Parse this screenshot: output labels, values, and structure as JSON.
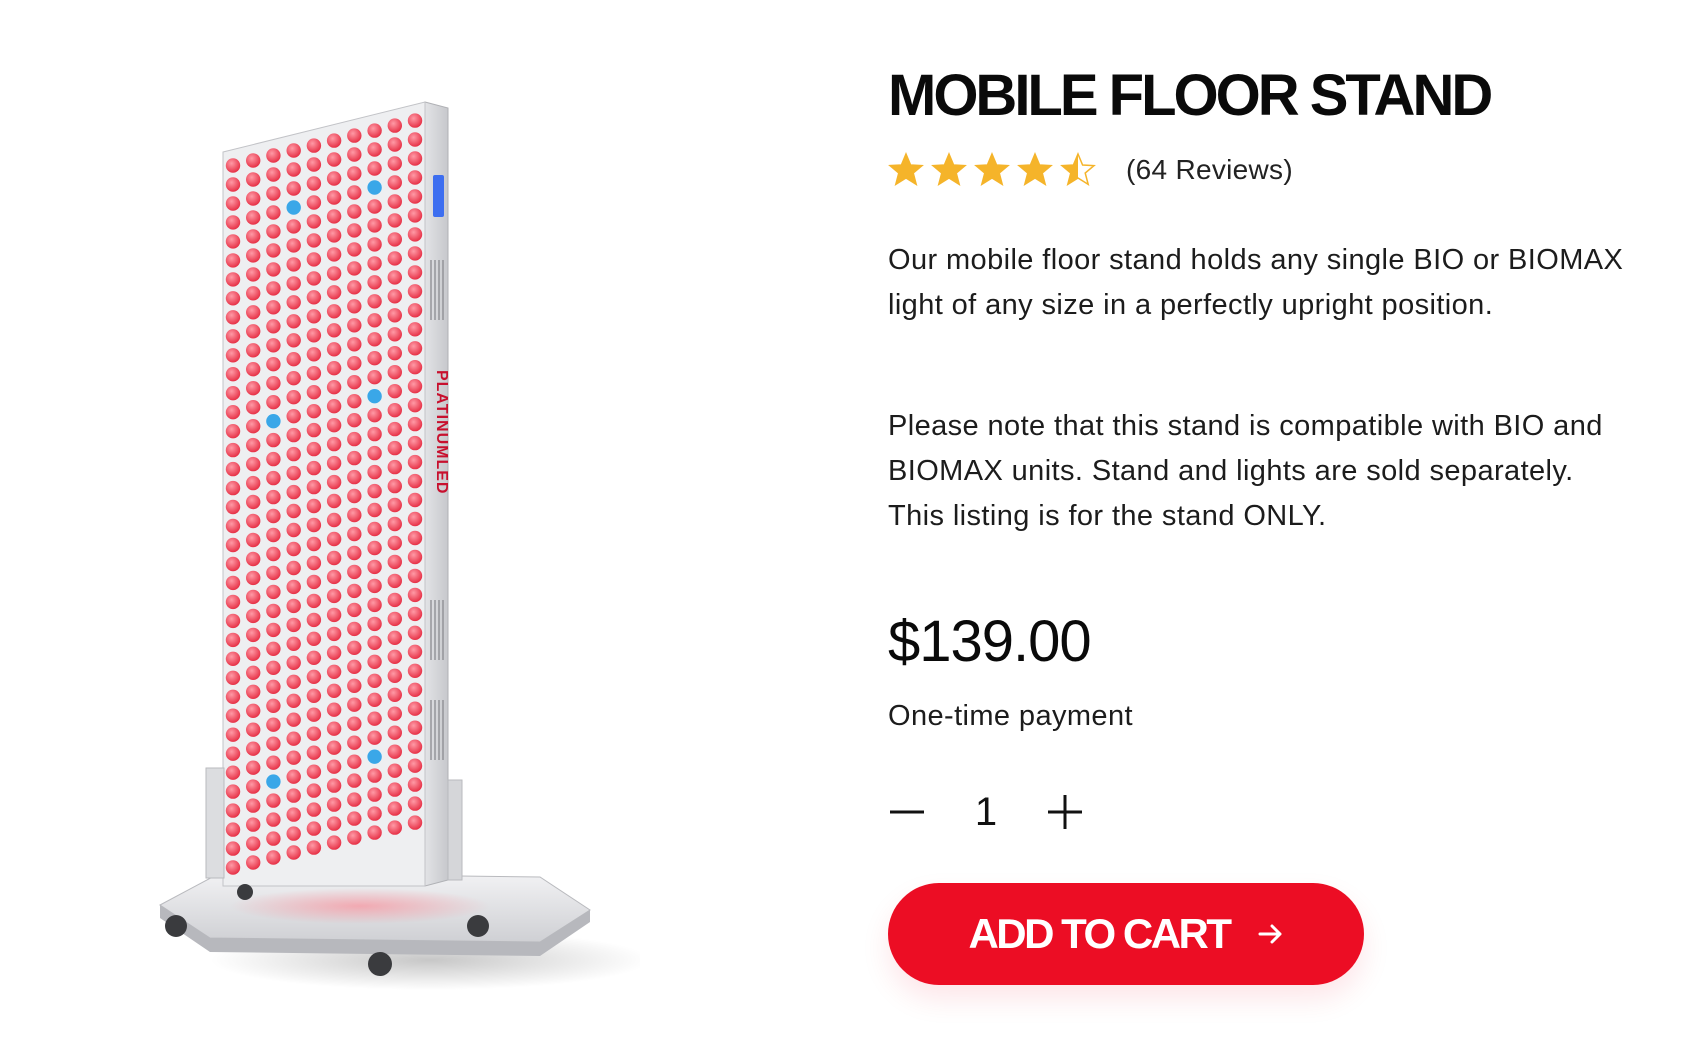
{
  "product": {
    "title": "MOBILE FLOOR STAND",
    "rating": 4.5,
    "reviews_label": "(64 Reviews)",
    "description": [
      "Our mobile floor stand holds any single BIO or BIOMAX light of any size in a perfectly upright position.",
      "Please note that this stand is compatible with BIO and BIOMAX units. Stand and lights are sold separately. This listing is for the stand ONLY."
    ],
    "price": "$139.00",
    "payment_type": "One-time payment",
    "quantity": "1",
    "add_to_cart_label": "ADD TO CART",
    "image_brand_text": "PLATINUMLED"
  },
  "colors": {
    "accent": "#ec0d24",
    "star": "#f5b42a",
    "led_red": "#ec2f45",
    "led_blue": "#3aa7e8"
  },
  "icons": {
    "star": "star-icon",
    "minus": "minus-icon",
    "plus": "plus-icon",
    "arrow": "arrow-right-icon"
  }
}
